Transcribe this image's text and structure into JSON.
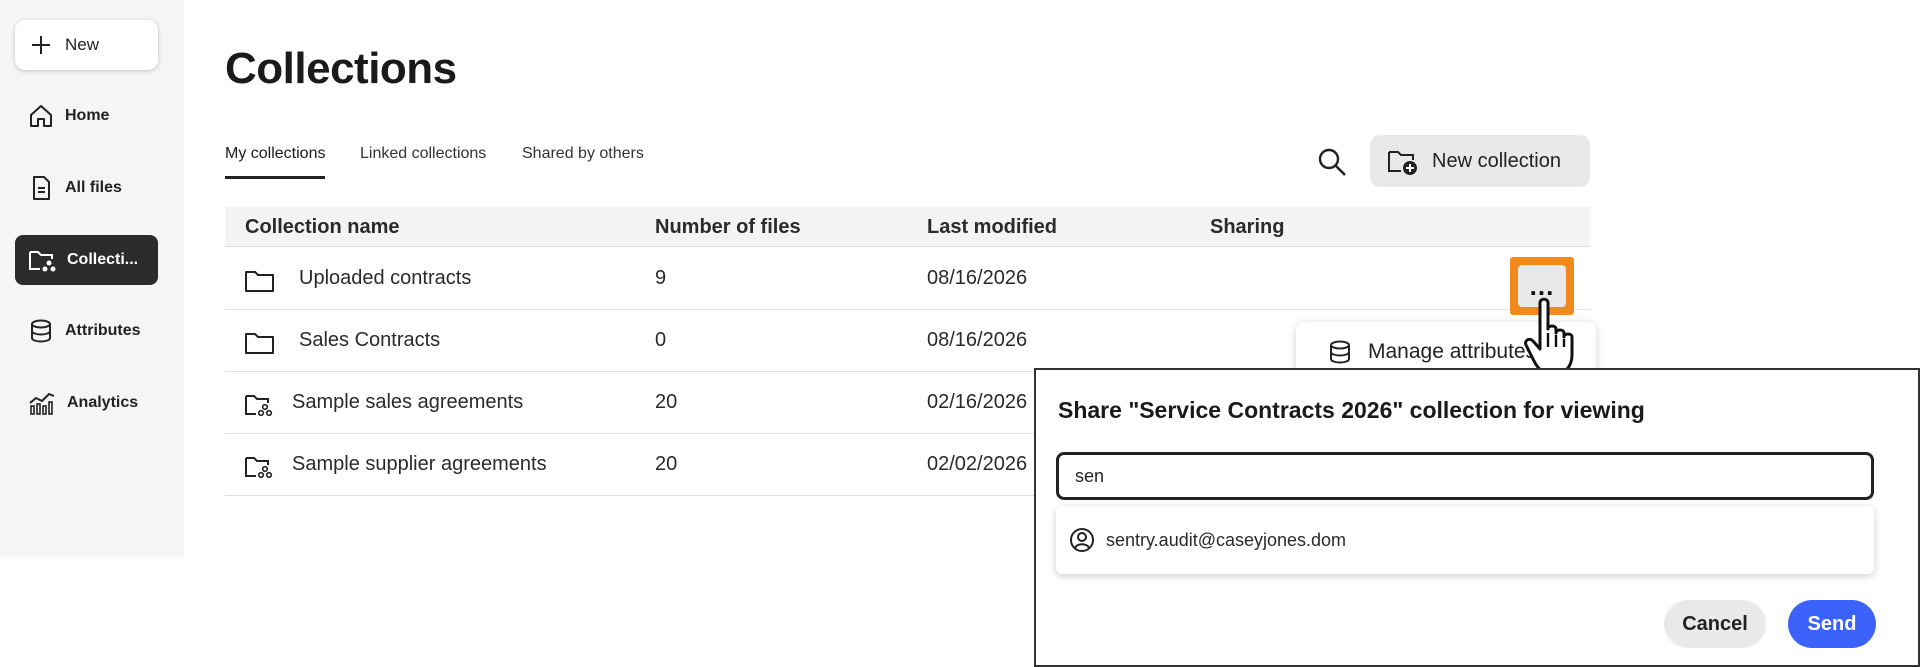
{
  "sidebar": {
    "new_label": "New",
    "items": [
      {
        "label": "Home",
        "icon": "home-icon"
      },
      {
        "label": "All files",
        "icon": "file-icon"
      },
      {
        "label": "Collecti...",
        "icon": "folder-shared-icon",
        "active": true
      },
      {
        "label": "Attributes",
        "icon": "database-icon"
      },
      {
        "label": "Analytics",
        "icon": "analytics-icon"
      }
    ]
  },
  "main": {
    "title": "Collections",
    "tabs": [
      {
        "label": "My collections",
        "active": true
      },
      {
        "label": "Linked collections"
      },
      {
        "label": "Shared by others"
      }
    ],
    "new_collection_label": "New collection",
    "table": {
      "columns": [
        "Collection name",
        "Number of files",
        "Last modified",
        "Sharing"
      ],
      "rows": [
        {
          "name": "Uploaded contracts",
          "files": "9",
          "modified": "08/16/2026",
          "icon": "folder-icon"
        },
        {
          "name": "Sales Contracts",
          "files": "0",
          "modified": "08/16/2026",
          "icon": "folder-icon"
        },
        {
          "name": "Sample sales agreements",
          "files": "20",
          "modified": "02/16/2026",
          "icon": "folder-shared-icon"
        },
        {
          "name": "Sample supplier agreements",
          "files": "20",
          "modified": "02/02/2026",
          "icon": "folder-shared-icon"
        }
      ]
    },
    "more_label": "...",
    "context_menu": {
      "item": "Manage attributes"
    }
  },
  "dialog": {
    "title": "Share \"Service Contracts 2026\" collection for viewing",
    "input_value": "sen",
    "suggestion": "sentry.audit@caseyjones.dom",
    "cancel_label": "Cancel",
    "send_label": "Send"
  },
  "colors": {
    "accent_blue": "#3b63fb",
    "highlight_orange": "#f08a1c",
    "sidebar_active": "#2c2c2c"
  }
}
